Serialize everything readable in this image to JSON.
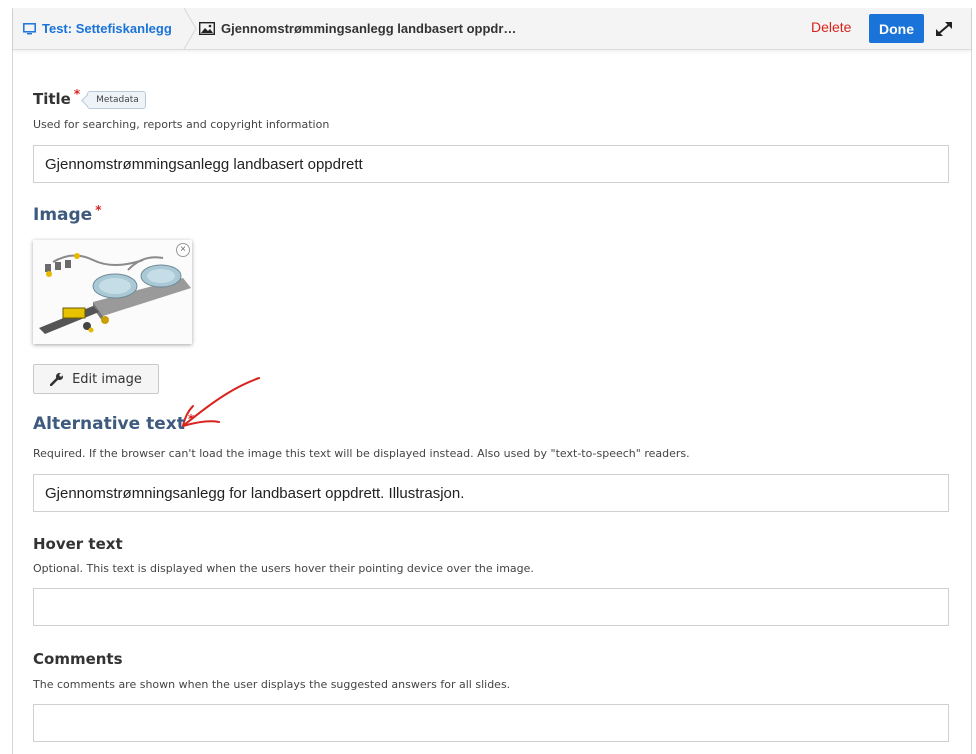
{
  "header": {
    "breadcrumb_root": "Test: Settefiskanlegg",
    "breadcrumb_current": "Gjennomstrømmingsanlegg landbasert oppdr…",
    "delete_label": "Delete",
    "done_label": "Done",
    "root_icon": "monitor-icon",
    "current_icon": "image-icon",
    "expand_icon": "expand-arrows-icon"
  },
  "form": {
    "title": {
      "label": "Title",
      "required_mark": "*",
      "tag": "Metadata",
      "description": "Used for searching, reports and copyright information",
      "value": "Gjennomstrømmingsanlegg landbasert oppdrett"
    },
    "image": {
      "label": "Image",
      "required_mark": "*",
      "edit_label": "Edit image",
      "edit_icon": "wrench-icon",
      "remove_symbol": "×"
    },
    "alt_text": {
      "label": "Alternative text",
      "required_mark": "*",
      "description": "Required. If the browser can't load the image this text will be displayed instead. Also used by \"text-to-speech\" readers.",
      "value": "Gjennomstrømningsanlegg for landbasert oppdrett. Illustrasjon."
    },
    "hover_text": {
      "label": "Hover text",
      "description": "Optional. This text is displayed when the users hover their pointing device over the image.",
      "value": ""
    },
    "comments": {
      "label": "Comments",
      "description": "The comments are shown when the user displays the suggested answers for all slides.",
      "value": ""
    }
  },
  "colors": {
    "link_blue": "#1a73d9",
    "required_red": "#d9231d",
    "section_blue": "#3e5a7e",
    "annotation_red": "#d9231d"
  }
}
